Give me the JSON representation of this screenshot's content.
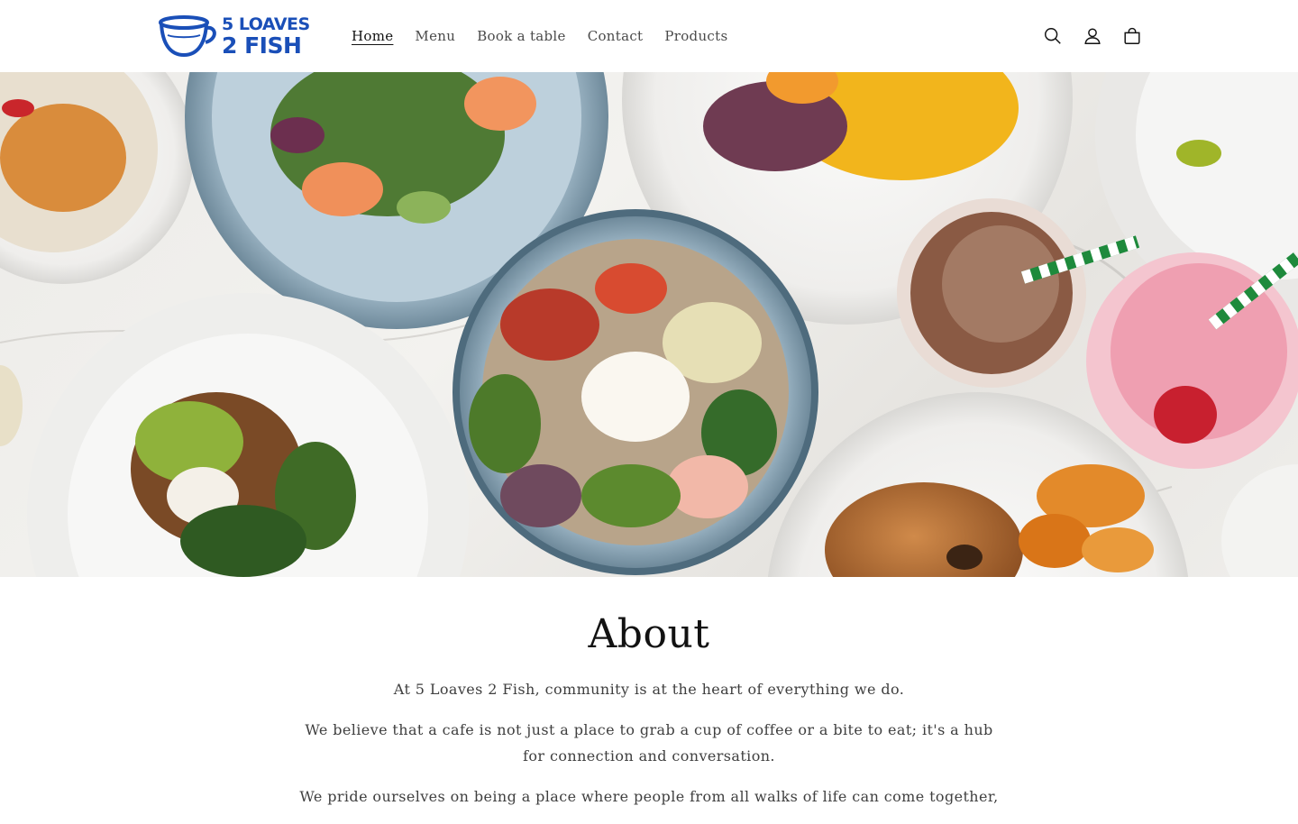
{
  "header": {
    "logo": {
      "line1": "5 LOAVES",
      "line2": "2 FISH",
      "brand_color": "#1a4fb8",
      "icon": "coffee-cup-icon"
    },
    "nav": [
      {
        "label": "Home",
        "active": true
      },
      {
        "label": "Menu",
        "active": false
      },
      {
        "label": "Book a table",
        "active": false
      },
      {
        "label": "Contact",
        "active": false
      },
      {
        "label": "Products",
        "active": false
      }
    ],
    "icons": [
      "search-icon",
      "account-icon",
      "cart-icon"
    ]
  },
  "hero": {
    "image": "overhead-cafe-food-spread",
    "icon": "food-photo"
  },
  "about": {
    "title": "About",
    "paragraphs": [
      "At 5 Loaves 2 Fish, community is at the heart of everything we do.",
      "We believe that a cafe is not just a place to grab a cup of coffee or a bite to eat; it's a hub for connection and conversation.",
      "We pride ourselves on being a place where people from all walks of life can come together,"
    ]
  }
}
